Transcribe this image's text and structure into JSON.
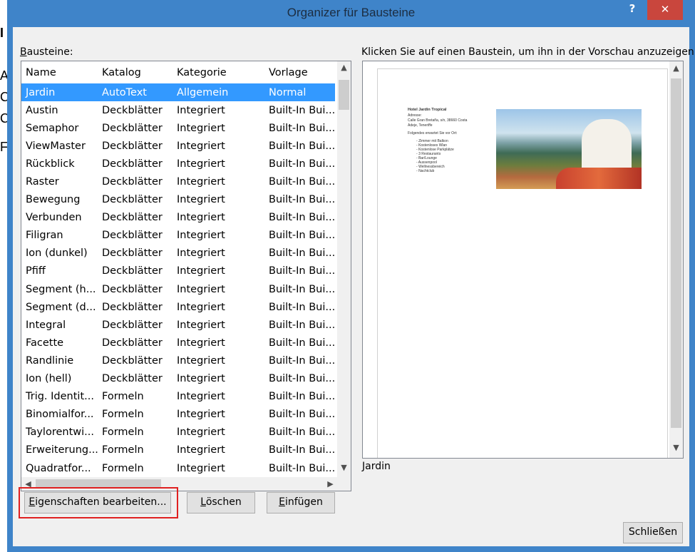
{
  "window": {
    "title": "Organizer für Bausteine",
    "help_label": "?",
    "close_label": "✕"
  },
  "list": {
    "label": "Bausteine:",
    "label_ul": "B",
    "label_rest": "austeine:",
    "columns": [
      "Name",
      "Katalog",
      "Kategorie",
      "Vorlage"
    ],
    "selected_index": 0,
    "rows": [
      [
        "Jardin",
        "AutoText",
        "Allgemein",
        "Normal"
      ],
      [
        "Austin",
        "Deckblätter",
        "Integriert",
        "Built-In Bui..."
      ],
      [
        "Semaphor",
        "Deckblätter",
        "Integriert",
        "Built-In Bui..."
      ],
      [
        "ViewMaster",
        "Deckblätter",
        "Integriert",
        "Built-In Bui..."
      ],
      [
        "Rückblick",
        "Deckblätter",
        "Integriert",
        "Built-In Bui..."
      ],
      [
        "Raster",
        "Deckblätter",
        "Integriert",
        "Built-In Bui..."
      ],
      [
        "Bewegung",
        "Deckblätter",
        "Integriert",
        "Built-In Bui..."
      ],
      [
        "Verbunden",
        "Deckblätter",
        "Integriert",
        "Built-In Bui..."
      ],
      [
        "Filigran",
        "Deckblätter",
        "Integriert",
        "Built-In Bui..."
      ],
      [
        "Ion (dunkel)",
        "Deckblätter",
        "Integriert",
        "Built-In Bui..."
      ],
      [
        "Pfiff",
        "Deckblätter",
        "Integriert",
        "Built-In Bui..."
      ],
      [
        "Segment (h...",
        "Deckblätter",
        "Integriert",
        "Built-In Bui..."
      ],
      [
        "Segment (d...",
        "Deckblätter",
        "Integriert",
        "Built-In Bui..."
      ],
      [
        "Integral",
        "Deckblätter",
        "Integriert",
        "Built-In Bui..."
      ],
      [
        "Facette",
        "Deckblätter",
        "Integriert",
        "Built-In Bui..."
      ],
      [
        "Randlinie",
        "Deckblätter",
        "Integriert",
        "Built-In Bui..."
      ],
      [
        "Ion (hell)",
        "Deckblätter",
        "Integriert",
        "Built-In Bui..."
      ],
      [
        "Trig. Identit...",
        "Formeln",
        "Integriert",
        "Built-In Bui..."
      ],
      [
        "Binomialfor...",
        "Formeln",
        "Integriert",
        "Built-In Bui..."
      ],
      [
        "Taylorentwi...",
        "Formeln",
        "Integriert",
        "Built-In Bui..."
      ],
      [
        "Erweiterung...",
        "Formeln",
        "Integriert",
        "Built-In Bui..."
      ],
      [
        "Quadratfor...",
        "Formeln",
        "Integriert",
        "Built-In Bui..."
      ]
    ]
  },
  "preview": {
    "label": "Klicken Sie auf einen Baustein, um ihn in der Vorschau anzuzeigen.",
    "name": "Jardin",
    "doc_title": "Hotel Jardin Tropical",
    "doc_lines": [
      "Adresse:",
      "Calle Gran Bretaña, s/n, 38660 Costa",
      "Adeje, Teneriffe",
      "",
      "Folgendes erwartet Sie vor Ort:"
    ],
    "doc_items": [
      "Zimmer mit Balkon",
      "Kostenloses Wlan",
      "Kostenlose Parkplätze",
      "3 Restaurants",
      "Bar/Lounge",
      "Aussenpool",
      "Wellnessbereich",
      "Nachtclub"
    ]
  },
  "buttons": {
    "props_ul": "E",
    "props_rest": "igenschaften bearbeiten...",
    "delete_ul": "L",
    "delete_rest": "öschen",
    "insert_ul": "E",
    "insert_rest": "infügen",
    "close": "Schließen"
  },
  "colors": {
    "titlebar": "#3f84c9",
    "close": "#c9463d",
    "selection": "#3399ff",
    "highlight": "#e02020"
  }
}
